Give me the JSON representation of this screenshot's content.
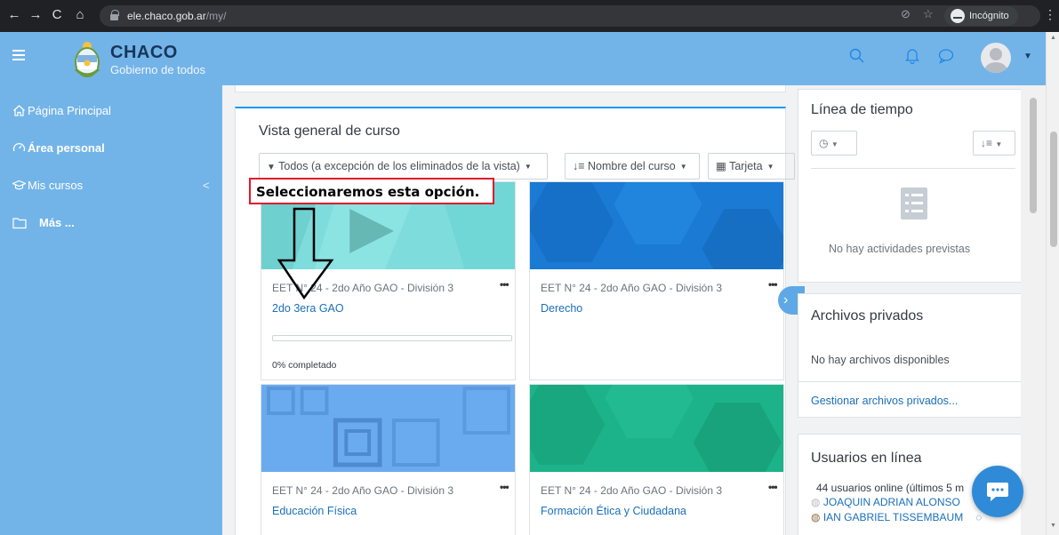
{
  "browser": {
    "url_host": "ele.chaco.gob.ar",
    "url_path": "/my/",
    "incognito_label": "Incógnito"
  },
  "header": {
    "brand_title": "CHACO",
    "brand_subtitle": "Gobierno de todos"
  },
  "sidebar": {
    "items": [
      {
        "label": "Página Principal",
        "icon": "home-icon"
      },
      {
        "label": "Área personal",
        "icon": "dashboard-icon"
      },
      {
        "label": "Mis cursos",
        "icon": "graduation-cap-icon"
      },
      {
        "label": "Más ...",
        "icon": "folder-icon"
      }
    ]
  },
  "course_overview": {
    "title": "Vista general de curso",
    "filter_label": "Todos (a excepción de los eliminados de la vista)",
    "sort_label": "Nombre del curso",
    "view_label": "Tarjeta",
    "courses": [
      {
        "category": "EET N° 24 - 2do Año GAO - División 3",
        "name": "2do 3era GAO",
        "progress_text": "0% completado",
        "progress": 0,
        "color": "#7fdcdc"
      },
      {
        "category": "EET N° 24 - 2do Año GAO - División 3",
        "name": "Derecho",
        "color": "#1a7ad4"
      },
      {
        "category": "EET N° 24 - 2do Año GAO - División 3",
        "name": "Educación Física",
        "color": "#6aabf0"
      },
      {
        "category": "EET N° 24 - 2do Año GAO - División 3",
        "name": "Formación Ética y Ciudadana",
        "color": "#1db38a"
      }
    ]
  },
  "annotation": {
    "text": "Seleccionaremos esta opción."
  },
  "timeline": {
    "title": "Línea de tiempo",
    "empty_text": "No hay actividades previstas"
  },
  "private_files": {
    "title": "Archivos privados",
    "empty_text": "No hay archivos disponibles",
    "manage_link": "Gestionar archivos privados..."
  },
  "online_users": {
    "title": "Usuarios en línea",
    "summary": "44 usuarios online (últimos 5 m",
    "users": [
      "JOAQUIN ADRIAN ALONSO",
      "IAN GABRIEL TISSEMBAUM"
    ]
  },
  "colors": {
    "sidebar": "#73b4e8",
    "link": "#1a6fb8",
    "accent": "#2196f3"
  }
}
